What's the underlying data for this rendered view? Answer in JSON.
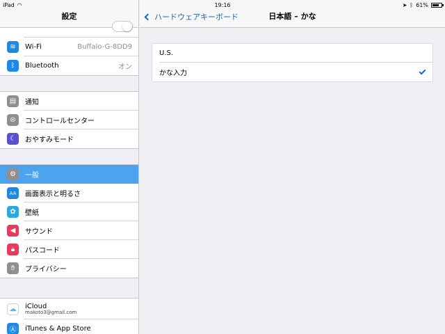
{
  "status": {
    "device": "iPad",
    "clock": "19:16",
    "battery": "61%",
    "battery_level": 0.61
  },
  "sidebar": {
    "title": "設定",
    "group1": [
      {
        "label": "Wi-Fi",
        "value": "Buffalo-G-8DD9",
        "icon": "wifi-icon",
        "color": "#1e88e5"
      },
      {
        "label": "Bluetooth",
        "value": "オン",
        "icon": "bluetooth-icon",
        "color": "#1e88e5"
      }
    ],
    "group2": [
      {
        "label": "通知",
        "icon": "notification-icon",
        "color": "#8e8e93"
      },
      {
        "label": "コントロールセンター",
        "icon": "control-center-icon",
        "color": "#8e8e93"
      },
      {
        "label": "おやすみモード",
        "icon": "moon-icon",
        "color": "#5b4fcf"
      }
    ],
    "group3": [
      {
        "label": "一般",
        "icon": "gear-icon",
        "color": "#8e8e93",
        "selected": true
      },
      {
        "label": "画面表示と明るさ",
        "icon": "brightness-icon",
        "color": "#1e88e5"
      },
      {
        "label": "壁紙",
        "icon": "wallpaper-icon",
        "color": "#2aa9e0"
      },
      {
        "label": "サウンド",
        "icon": "speaker-icon",
        "color": "#e63b5a"
      },
      {
        "label": "パスコード",
        "icon": "lock-icon",
        "color": "#e63b5a"
      },
      {
        "label": "プライバシー",
        "icon": "hand-icon",
        "color": "#8e8e93"
      }
    ],
    "group4": [
      {
        "label": "iCloud",
        "sub": "makoto3@gmail.com",
        "icon": "icloud-icon",
        "color": "#ffffff"
      },
      {
        "label": "iTunes & App Store",
        "icon": "app-store-icon",
        "color": "#1e88e5"
      }
    ]
  },
  "detail": {
    "back_label": "ハードウェアキーボード",
    "title": "日本語 – かな",
    "options": [
      {
        "label": "U.S.",
        "checked": false
      },
      {
        "label": "かな入力",
        "checked": true
      }
    ]
  }
}
